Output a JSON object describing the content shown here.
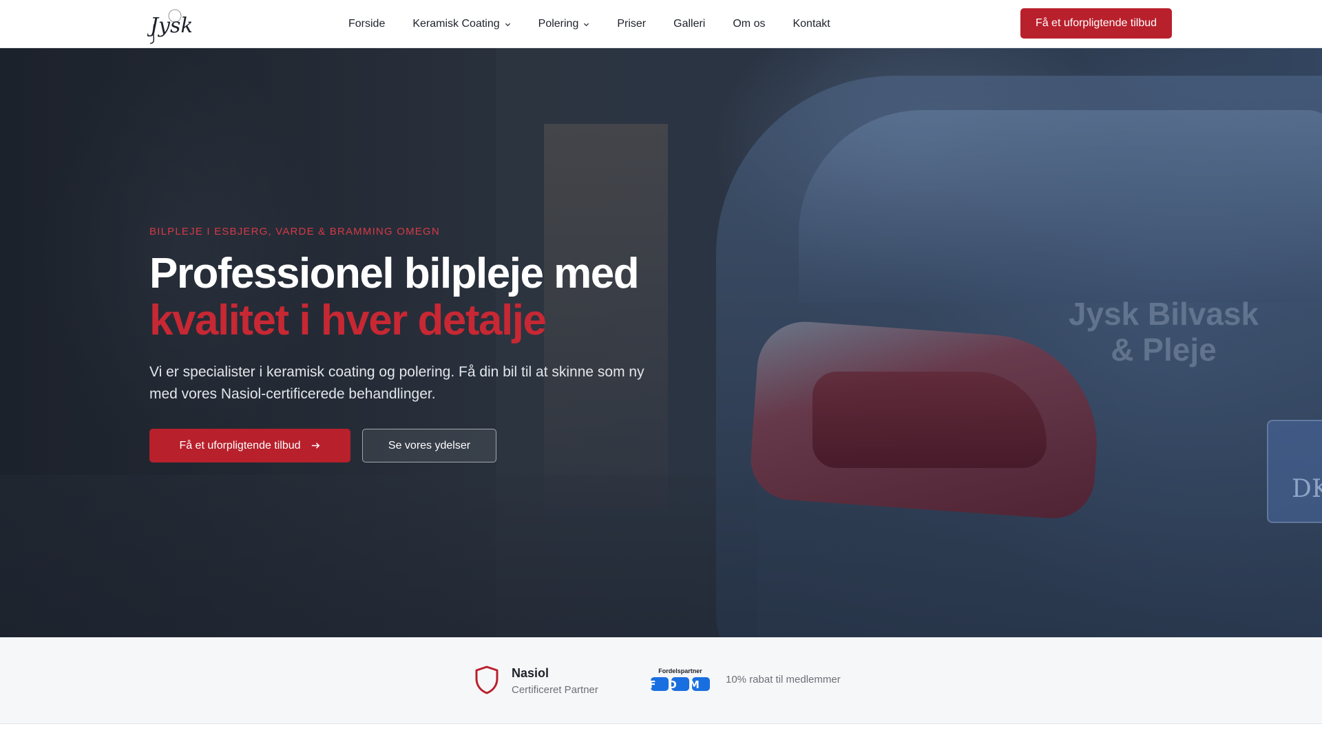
{
  "header": {
    "logo_text": "Jysk",
    "nav": [
      {
        "label": "Forside",
        "has_dropdown": false
      },
      {
        "label": "Keramisk Coating",
        "has_dropdown": true
      },
      {
        "label": "Polering",
        "has_dropdown": true
      },
      {
        "label": "Priser",
        "has_dropdown": false
      },
      {
        "label": "Galleri",
        "has_dropdown": false
      },
      {
        "label": "Om os",
        "has_dropdown": false
      },
      {
        "label": "Kontakt",
        "has_dropdown": false
      }
    ],
    "cta_label": "Få et uforpligtende tilbud"
  },
  "hero": {
    "eyebrow": "BILPLEJE I ESBJERG, VARDE & BRAMMING OMEGN",
    "title_line1": "Professionel bilpleje med",
    "title_line2": "kvalitet i hver detalje",
    "lead": "Vi er specialister i keramisk coating og polering. Få din bil til at skinne som ny med vores Nasiol-certificerede behandlinger.",
    "primary_button": "Få et uforpligtende tilbud",
    "secondary_button": "Se vores ydelser",
    "watermark": "Jysk Bilvask & Pleje",
    "plate_text": "DK"
  },
  "partners": {
    "nasiol_name": "Nasiol",
    "nasiol_sub": "Certificeret Partner",
    "fdm_top": "Fordelspartner",
    "fdm_logo": "FDM",
    "fdm_text": "10% rabat til medlemmer"
  },
  "colors": {
    "accent": "#b8202c",
    "accent_text": "#c72833",
    "fdm_blue": "#1a6fe0"
  },
  "icons": {
    "dropdown": "chevron-down-icon",
    "button_arrow": "arrow-right-icon",
    "nasiol": "shield-icon"
  }
}
